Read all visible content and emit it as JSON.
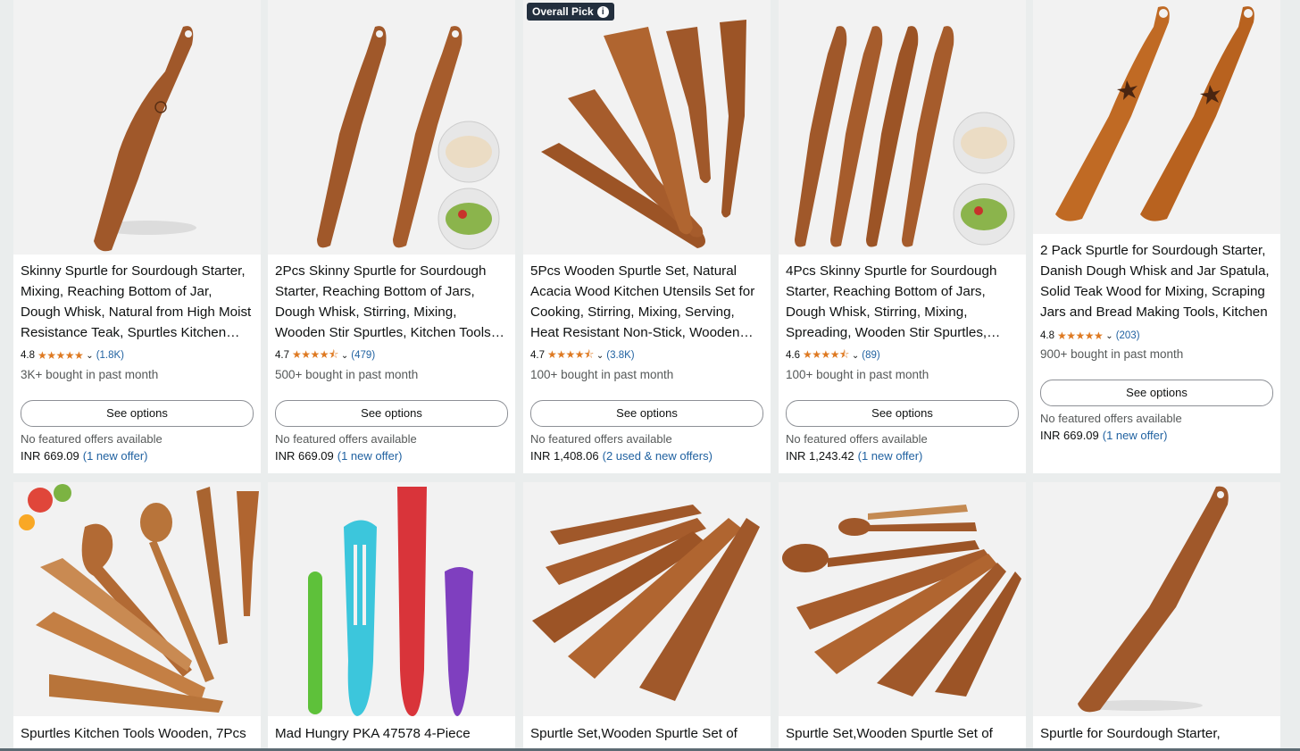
{
  "badge": {
    "label": "Overall Pick",
    "icon": "info-icon"
  },
  "colors": {
    "star": "#de7921",
    "link": "#2162a1",
    "wood": "#a0582a",
    "badge_bg": "#232f3e"
  },
  "products": [
    {
      "title": "Skinny Spurtle for Sourdough Starter, Mixing, Reaching Bottom of Jar, Dough Whisk, Natural from High Moist Resistance Teak, Spurtles Kitchen Tools",
      "rating": "4.8",
      "stars": "★★★★★",
      "count": "(1.8K)",
      "bought": "3K+ bought in past month",
      "button": "See options",
      "no_offers": "No featured offers available",
      "price": "INR 669.09",
      "offer": "(1 new offer)"
    },
    {
      "title": "2Pcs Skinny Spurtle for Sourdough Starter, Reaching Bottom of Jars, Dough Whisk, Stirring, Mixing, Wooden Stir Spurtles, Kitchen Tools Set",
      "rating": "4.7",
      "stars": "★★★★⯪",
      "count": "(479)",
      "bought": "500+ bought in past month",
      "button": "See options",
      "no_offers": "No featured offers available",
      "price": "INR 669.09",
      "offer": "(1 new offer)"
    },
    {
      "title": "5Pcs Wooden Spurtle Set, Natural Acacia Wood Kitchen Utensils Set for Cooking, Stirring, Mixing, Serving, Heat Resistant Non-Stick, Wooden Spoons",
      "rating": "4.7",
      "stars": "★★★★⯪",
      "count": "(3.8K)",
      "bought": "100+ bought in past month",
      "button": "See options",
      "no_offers": "No featured offers available",
      "price": "INR 1,408.06",
      "offer": "(2 used & new offers)"
    },
    {
      "title": "4Pcs Skinny Spurtle for Sourdough Starter, Reaching Bottom of Jars, Dough Whisk, Stirring, Mixing, Spreading, Wooden Stir Spurtles, Kitchen",
      "rating": "4.6",
      "stars": "★★★★⯪",
      "count": "(89)",
      "bought": "100+ bought in past month",
      "button": "See options",
      "no_offers": "No featured offers available",
      "price": "INR 1,243.42",
      "offer": "(1 new offer)"
    },
    {
      "title": "2 Pack Spurtle for Sourdough Starter, Danish Dough Whisk and Jar Spatula, Solid Teak Wood for Mixing, Scraping Jars and Bread Making Tools, Kitchen",
      "rating": "4.8",
      "stars": "★★★★★",
      "count": "(203)",
      "bought": "900+ bought in past month",
      "button": "See options",
      "no_offers": "No featured offers available",
      "price": "INR 669.09",
      "offer": "(1 new offer)"
    }
  ],
  "row2_titles": [
    "Spurtles Kitchen Tools Wooden, 7Pcs",
    "Mad Hungry PKA 47578 4-Piece",
    "Spurtle Set,Wooden Spurtle Set of",
    "Spurtle Set,Wooden Spurtle Set of",
    "Spurtle for Sourdough Starter,"
  ]
}
